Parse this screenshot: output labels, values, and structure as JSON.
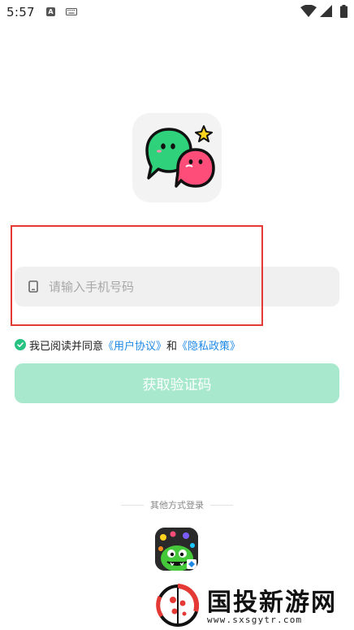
{
  "status_bar": {
    "time": "5:57",
    "notification_letter": "A"
  },
  "login": {
    "phone_placeholder": "请输入手机号码",
    "agree_prefix": "我已阅读并同意",
    "user_agreement": "《用户协议》",
    "and": "和",
    "privacy_policy": "《隐私政策》",
    "get_code_button": "获取验证码"
  },
  "other_login": {
    "label": "其他方式登录"
  },
  "watermark": {
    "title": "国投新游网",
    "url": "www.sxsgytr.com"
  },
  "colors": {
    "accent_green": "#26c281",
    "button_disabled": "#a8e8cc",
    "link_blue": "#1e88e5",
    "highlight_red": "#e53935"
  },
  "icons": {
    "phone": "phone-icon",
    "check": "check-circle-icon",
    "logo": "chat-bubbles-logo"
  }
}
